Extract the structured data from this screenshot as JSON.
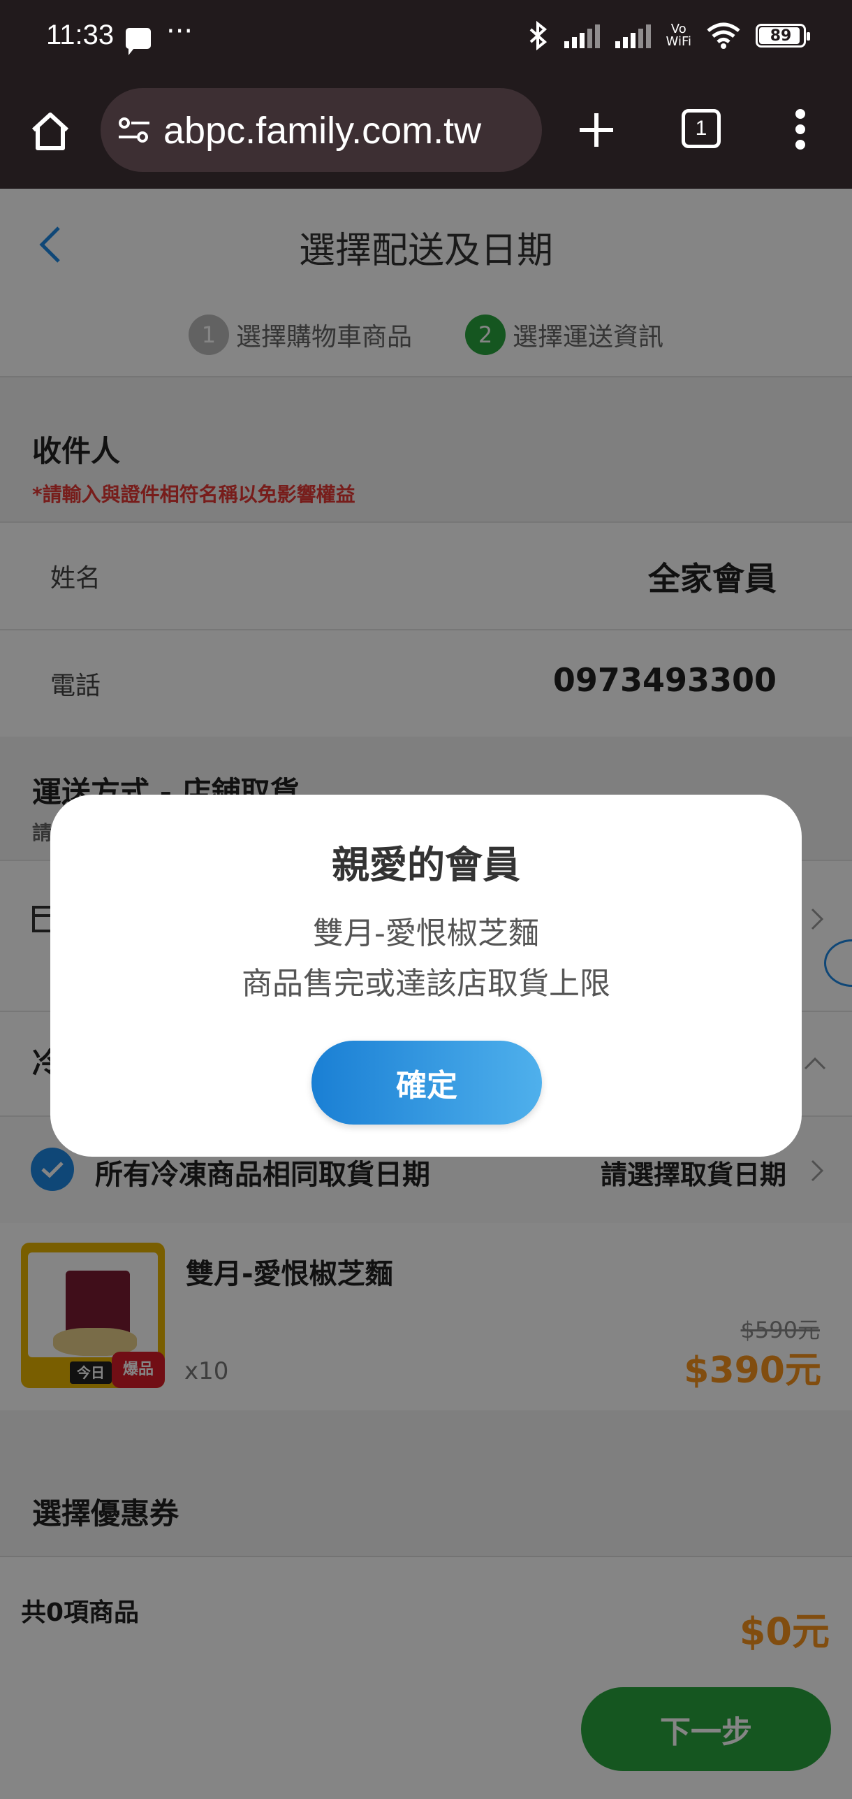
{
  "status_bar": {
    "time": "11:33",
    "icons": [
      "message-icon",
      "more-dots-icon",
      "bluetooth-icon",
      "signal-icon",
      "signal-icon",
      "vowifi-icon",
      "wifi-icon",
      "battery-icon"
    ],
    "more": "···",
    "vowifi_top": "Vo",
    "vowifi_bottom": "WiFi",
    "battery": "89"
  },
  "browser": {
    "url": "abpc.family.com.tw",
    "tab_count": "1"
  },
  "page": {
    "title": "選擇配送及日期",
    "steps": [
      {
        "num": "1",
        "label": "選擇購物車商品",
        "active": false
      },
      {
        "num": "2",
        "label": "選擇運送資訊",
        "active": true
      }
    ],
    "recipient": {
      "title": "收件人",
      "warning": "*請輸入與證件相符名稱以免影響權益",
      "name_label": "姓名",
      "name_value": "全家會員",
      "phone_label": "電話",
      "phone_value": "0973493300"
    },
    "shipping": {
      "title": "運送方式 - 店鋪取貨",
      "subtitle": "請"
    },
    "frozen": {
      "title": "冷",
      "same_date_label": "所有冷凍商品相同取貨日期",
      "select_date": "請選擇取貨日期"
    },
    "product": {
      "name": "雙月-愛恨椒芝麵",
      "qty": "x10",
      "original_price": "$590元",
      "price": "$390元",
      "badge_today": "今日",
      "badge_hot": "爆品"
    },
    "coupon": {
      "title": "選擇優惠券"
    },
    "footer": {
      "total_label": "共0項商品",
      "total_price": "$0元",
      "next": "下一步"
    }
  },
  "modal": {
    "title": "親愛的會員",
    "line1": "雙月-愛恨椒芝麵",
    "line2": "商品售完或達該店取貨上限",
    "confirm": "確定"
  },
  "colors": {
    "accent_green": "#2aa53e",
    "accent_blue": "#1e88e5",
    "price_orange": "#f7941d",
    "warning_red": "#e53935"
  }
}
